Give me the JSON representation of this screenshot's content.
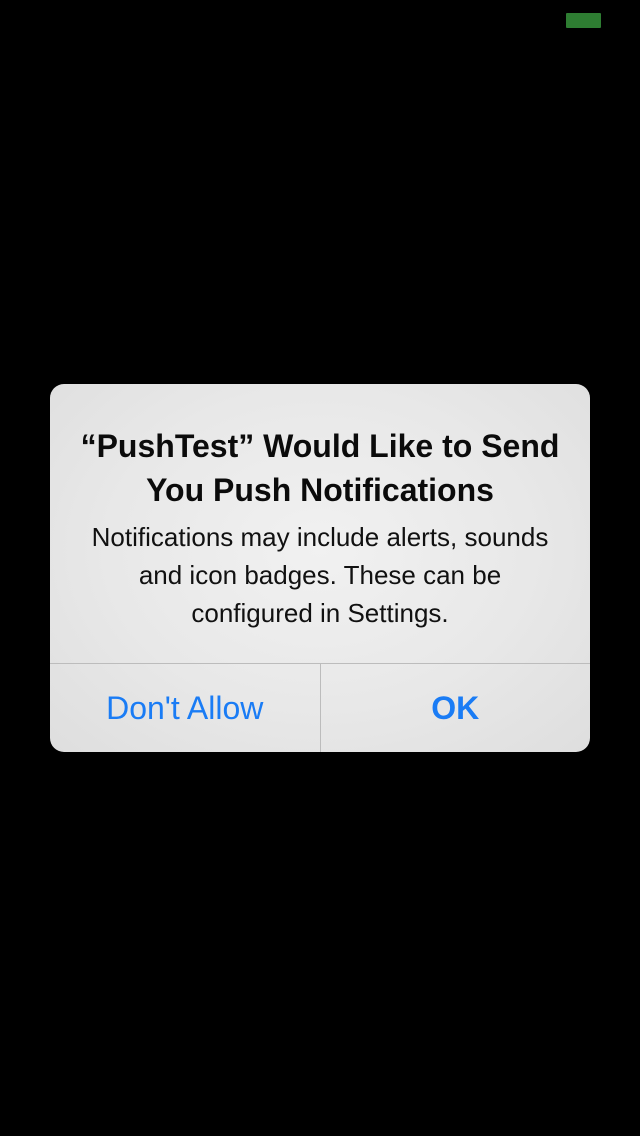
{
  "status_bar": {
    "battery_color": "#2e7d32"
  },
  "alert": {
    "title": "“PushTest” Would Like to Send You Push Notifications",
    "message": "Notifications may include alerts, sounds and icon badges. These can be configured in Settings.",
    "buttons": [
      {
        "label": "Don't Allow",
        "color": "#1a7cf5"
      },
      {
        "label": "OK",
        "color": "#1a7cf5"
      }
    ]
  }
}
